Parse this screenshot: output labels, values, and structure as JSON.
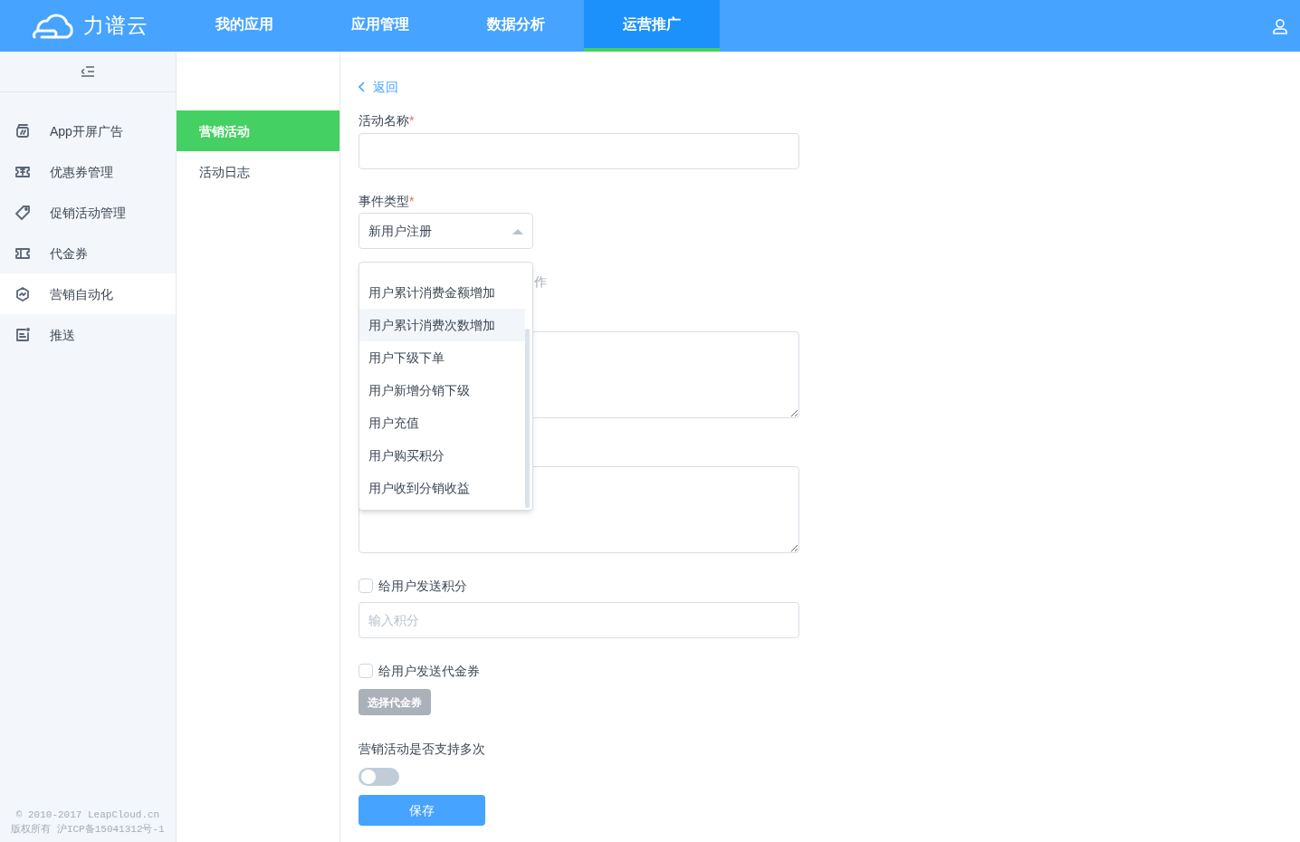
{
  "header": {
    "logo_text": "力谱云",
    "nav": [
      {
        "label": "我的应用",
        "selected": false
      },
      {
        "label": "应用管理",
        "selected": false
      },
      {
        "label": "数据分析",
        "selected": false
      },
      {
        "label": "运营推广",
        "selected": true
      }
    ]
  },
  "sidebar": {
    "items": [
      {
        "label": "App开屏广告",
        "kind": "ad",
        "selected": false
      },
      {
        "label": "优惠券管理",
        "kind": "coupon",
        "selected": false
      },
      {
        "label": "促销活动管理",
        "kind": "tag",
        "selected": false
      },
      {
        "label": "代金券",
        "kind": "ticket",
        "selected": false
      },
      {
        "label": "营销自动化",
        "kind": "auto",
        "selected": true
      },
      {
        "label": "推送",
        "kind": "push",
        "selected": false
      }
    ],
    "footer": [
      "© 2010-2017 LeapCloud.cn",
      "版权所有 沪ICP备15041312号-1"
    ]
  },
  "subnav": [
    {
      "label": "营销活动",
      "selected": true
    },
    {
      "label": "活动日志",
      "selected": false
    }
  ],
  "form": {
    "back": "返回",
    "name_label": "活动名称",
    "required_mark": "*",
    "event_label": "事件类型",
    "event_select": {
      "value": "新用户注册",
      "expanded": true
    },
    "hint_fragment": "作",
    "dropdown": [
      {
        "label": "用户累计消费金额增加",
        "selected": false
      },
      {
        "label": "用户累计消费次数增加",
        "selected": true
      },
      {
        "label": "用户下级下单",
        "selected": false
      },
      {
        "label": "用户新增分销下级",
        "selected": false
      },
      {
        "label": "用户充值",
        "selected": false
      },
      {
        "label": "用户购买积分",
        "selected": false
      },
      {
        "label": "用户收到分销收益",
        "selected": false
      }
    ],
    "points_check": {
      "label": "给用户发送积分",
      "checked": false
    },
    "points_input": {
      "placeholder": "输入积分"
    },
    "voucher_check": {
      "label": "给用户发送代金券",
      "checked": false
    },
    "voucher_button": {
      "label": "选择代金券",
      "disabled": true
    },
    "repeat_label": "营销活动是否支持多次",
    "repeat_toggle": {
      "on": false
    },
    "save": "保存"
  }
}
